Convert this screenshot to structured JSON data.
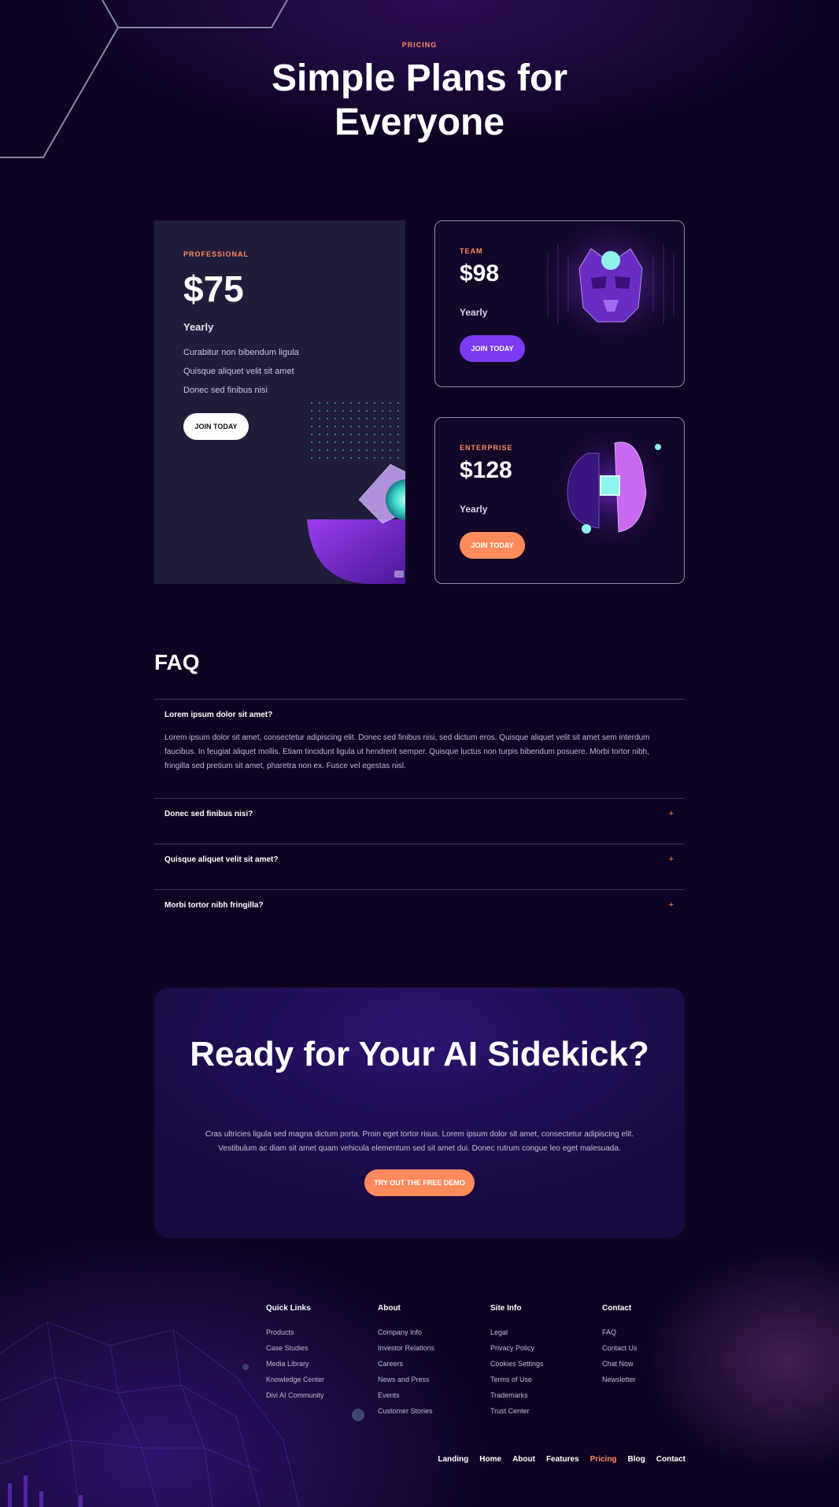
{
  "hero": {
    "eyebrow": "PRICING",
    "title": "Simple Plans for Everyone"
  },
  "plans": {
    "professional": {
      "label": "PROFESSIONAL",
      "price": "$75",
      "period": "Yearly",
      "features": [
        "Curabitur non bibendum ligula",
        "Quisque aliquet velit sit amet",
        "Donec sed finibus nisi"
      ],
      "button": "JOIN TODAY"
    },
    "team": {
      "label": "TEAM",
      "price": "$98",
      "period": "Yearly",
      "button": "JOIN TODAY"
    },
    "enterprise": {
      "label": "ENTERPRISE",
      "price": "$128",
      "period": "Yearly",
      "button": "JOIN TODAY"
    }
  },
  "faq": {
    "title": "FAQ",
    "items": [
      {
        "question": "Lorem ipsum dolor sit amet?",
        "answer": "Lorem ipsum dolor sit amet, consectetur adipiscing elit. Donec sed finibus nisi, sed dictum eros. Quisque aliquet velit sit amet sem interdum faucibus. In feugiat aliquet mollis. Etiam tincidunt ligula ut hendrerit semper. Quisque luctus non turpis bibendum posuere. Morbi tortor nibh, fringilla sed pretium sit amet, pharetra non ex. Fusce vel egestas nisl.",
        "expanded": true
      },
      {
        "question": "Donec sed finibus nisi?",
        "toggle": "+",
        "expanded": false
      },
      {
        "question": "Quisque aliquet velit sit amet?",
        "toggle": "+",
        "expanded": false
      },
      {
        "question": "Morbi tortor nibh fringilla?",
        "toggle": "+",
        "expanded": false
      }
    ]
  },
  "cta": {
    "title": "Ready for Your AI Sidekick?",
    "text": "Cras ultricies ligula sed magna dictum porta. Proin eget tortor risus. Lorem ipsum dolor sit amet, consectetur adipiscing elit. Vestibulum ac diam sit amet quam vehicula elementum sed sit amet dui. Donec rutrum congue leo eget malesuada.",
    "button": "TRY OUT THE FREE DEMO"
  },
  "footer": {
    "columns": [
      {
        "title": "Quick Links",
        "links": [
          "Products",
          "Case Studies",
          "Media Library",
          "Knowledge Center",
          "Divi AI Community"
        ]
      },
      {
        "title": "About",
        "links": [
          "Company Info",
          "Investor Relations",
          "Careers",
          "News and Press",
          "Events",
          "Customer Stories"
        ]
      },
      {
        "title": "Site Info",
        "links": [
          "Legal",
          "Privacy Policy",
          "Cookies Settings",
          "Terms of Use",
          "Trademarks",
          "Trust Center"
        ]
      },
      {
        "title": "Contact",
        "links": [
          "FAQ",
          "Contact Us",
          "Chat Now",
          "Newsletter"
        ]
      }
    ],
    "nav": [
      "Landing",
      "Home",
      "About",
      "Features",
      "Pricing",
      "Blog",
      "Contact"
    ],
    "active_nav": "Pricing"
  },
  "colors": {
    "accent_orange": "#ff8a5c",
    "accent_purple": "#7b3bf2",
    "background": "#0e0322"
  }
}
